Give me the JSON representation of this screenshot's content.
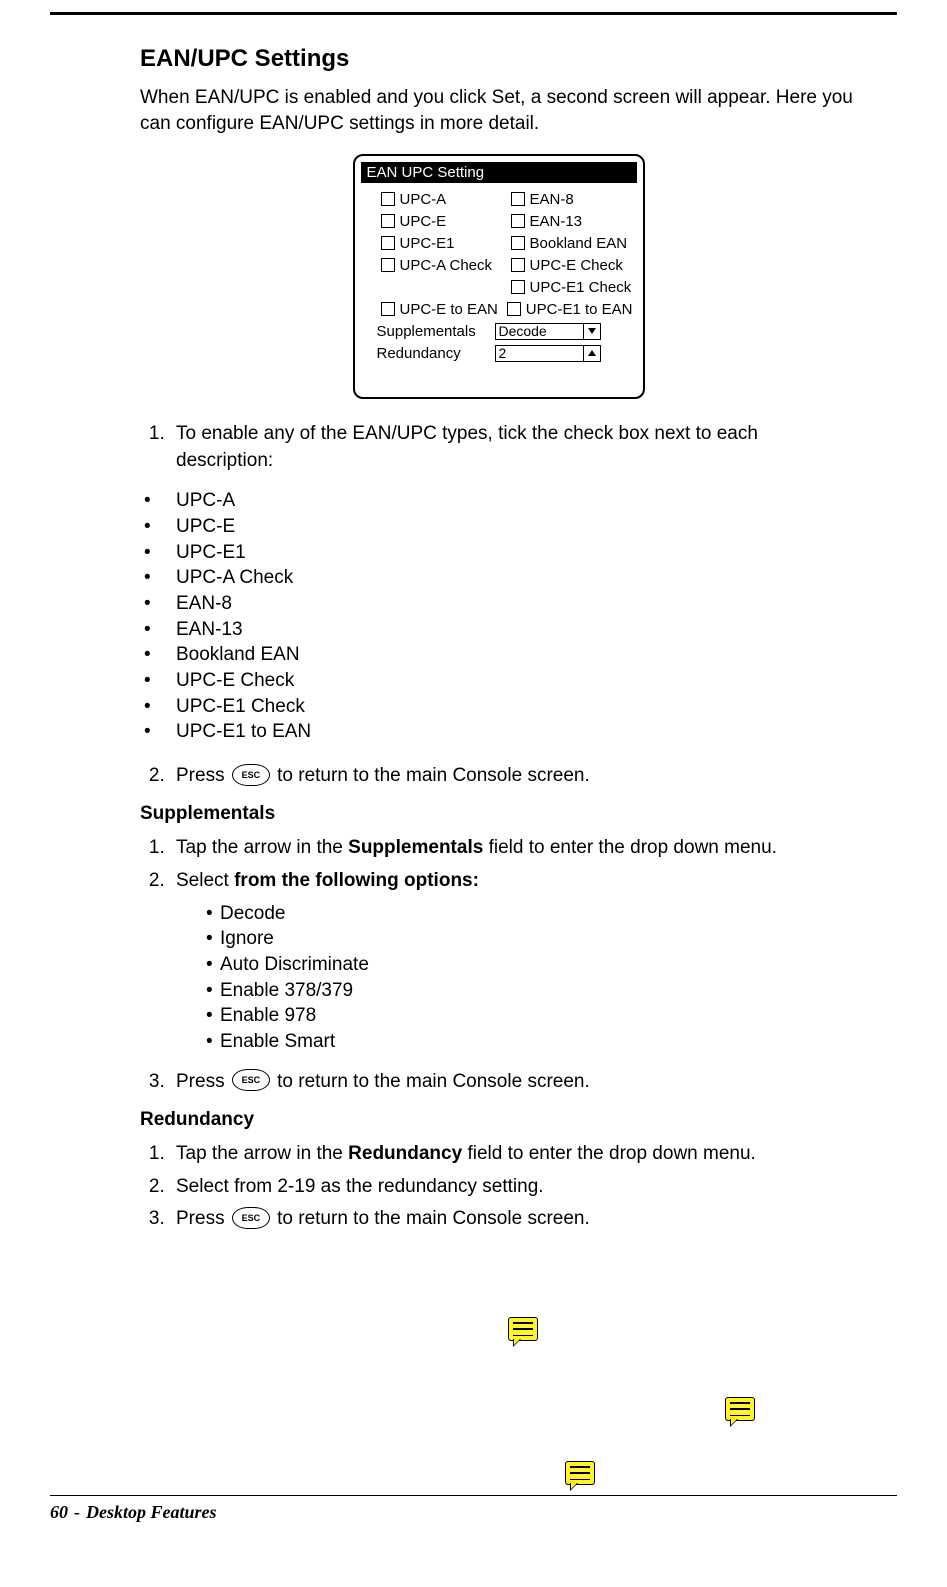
{
  "title": "EAN/UPC Settings",
  "intro": "When EAN/UPC is enabled and you click Set, a second screen will appear. Here you can configure EAN/UPC settings in more detail.",
  "dialog": {
    "header": "EAN UPC Setting",
    "left_col": [
      "UPC-A",
      "UPC-E",
      "UPC-E1",
      "UPC-A Check"
    ],
    "right_col": [
      "EAN-8",
      "EAN-13",
      "Bookland EAN",
      "UPC-E Check",
      "UPC-E1 Check"
    ],
    "long_row": {
      "left": "UPC-E to EAN",
      "right": "UPC-E1 to EAN"
    },
    "supplementals": {
      "label": "Supplementals",
      "value": "Decode"
    },
    "redundancy": {
      "label": "Redundancy",
      "value": "2"
    }
  },
  "step1": {
    "text": "To enable any of the EAN/UPC types, tick the check box next to each description:",
    "types": [
      "UPC-A",
      "UPC-E",
      "UPC-E1",
      "UPC-A Check",
      "EAN-8",
      "EAN-13",
      "Bookland EAN",
      "UPC-E Check",
      "UPC-E1 Check",
      "UPC-E1 to EAN"
    ]
  },
  "step2": {
    "pre": "Press ",
    "post": " to return to the main Console screen."
  },
  "supp": {
    "heading": "Supplementals",
    "s1_a": "Tap the arrow in the ",
    "s1_b": "Supplementals",
    "s1_c": " field to enter the drop down menu.",
    "s2_a": "Select ",
    "s2_b": "from the following options:",
    "options": [
      "Decode",
      "Ignore",
      "Auto Discriminate",
      "Enable 378/379",
      "Enable 978",
      "Enable Smart"
    ],
    "s3_pre": "Press ",
    "s3_post": " to return to the main Console screen."
  },
  "red": {
    "heading": "Redundancy",
    "s1_a": "Tap the arrow in the ",
    "s1_b": "Redundancy",
    "s1_c": " field to enter the drop down menu.",
    "s2": "Select from 2-19 as the redundancy setting.",
    "s3_pre": "Press ",
    "s3_post": " to return to the main Console screen."
  },
  "esc_label": "ESC",
  "footer": {
    "page_num": "60",
    "separator": "-",
    "chapter": "Desktop Features"
  }
}
